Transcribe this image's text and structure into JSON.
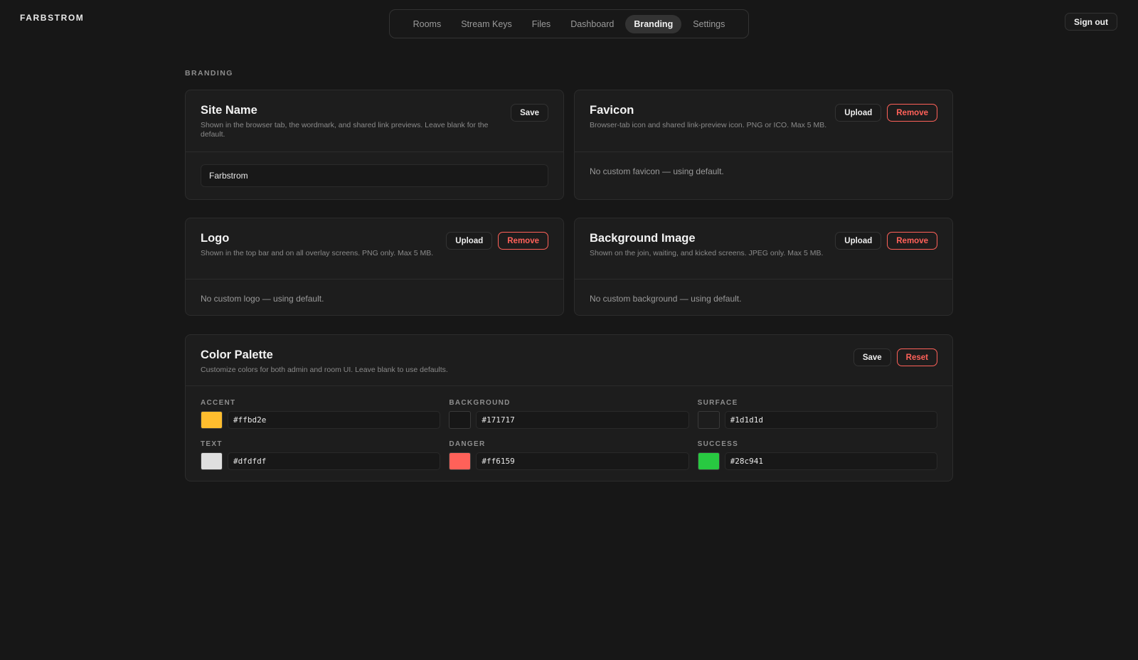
{
  "app": {
    "brand": "FARBSTROM"
  },
  "nav": {
    "tabs": [
      {
        "label": "Rooms",
        "active": false
      },
      {
        "label": "Stream Keys",
        "active": false
      },
      {
        "label": "Files",
        "active": false
      },
      {
        "label": "Dashboard",
        "active": false
      },
      {
        "label": "Branding",
        "active": true
      },
      {
        "label": "Settings",
        "active": false
      }
    ]
  },
  "header": {
    "signout_label": "Sign out"
  },
  "page": {
    "section_label": "BRANDING"
  },
  "cards": {
    "site_name": {
      "title": "Site Name",
      "desc": "Shown in the browser tab, the wordmark, and shared link previews. Leave blank for the default.",
      "save_label": "Save",
      "value": "Farbstrom"
    },
    "favicon": {
      "title": "Favicon",
      "desc": "Browser-tab icon and shared link-preview icon. PNG or ICO. Max 5 MB.",
      "upload_label": "Upload",
      "remove_label": "Remove",
      "status": "No custom favicon — using default."
    },
    "logo": {
      "title": "Logo",
      "desc": "Shown in the top bar and on all overlay screens. PNG only. Max 5 MB.",
      "upload_label": "Upload",
      "remove_label": "Remove",
      "status": "No custom logo — using default."
    },
    "background": {
      "title": "Background Image",
      "desc": "Shown on the join, waiting, and kicked screens. JPEG only. Max 5 MB.",
      "upload_label": "Upload",
      "remove_label": "Remove",
      "status": "No custom background — using default."
    },
    "palette": {
      "title": "Color Palette",
      "desc": "Customize colors for both admin and room UI. Leave blank to use defaults.",
      "save_label": "Save",
      "reset_label": "Reset",
      "colors": [
        {
          "label": "ACCENT",
          "value": "#ffbd2e"
        },
        {
          "label": "BACKGROUND",
          "value": "#171717"
        },
        {
          "label": "SURFACE",
          "value": "#1d1d1d"
        },
        {
          "label": "TEXT",
          "value": "#dfdfdf"
        },
        {
          "label": "DANGER",
          "value": "#ff6159"
        },
        {
          "label": "SUCCESS",
          "value": "#28c941"
        }
      ]
    }
  }
}
